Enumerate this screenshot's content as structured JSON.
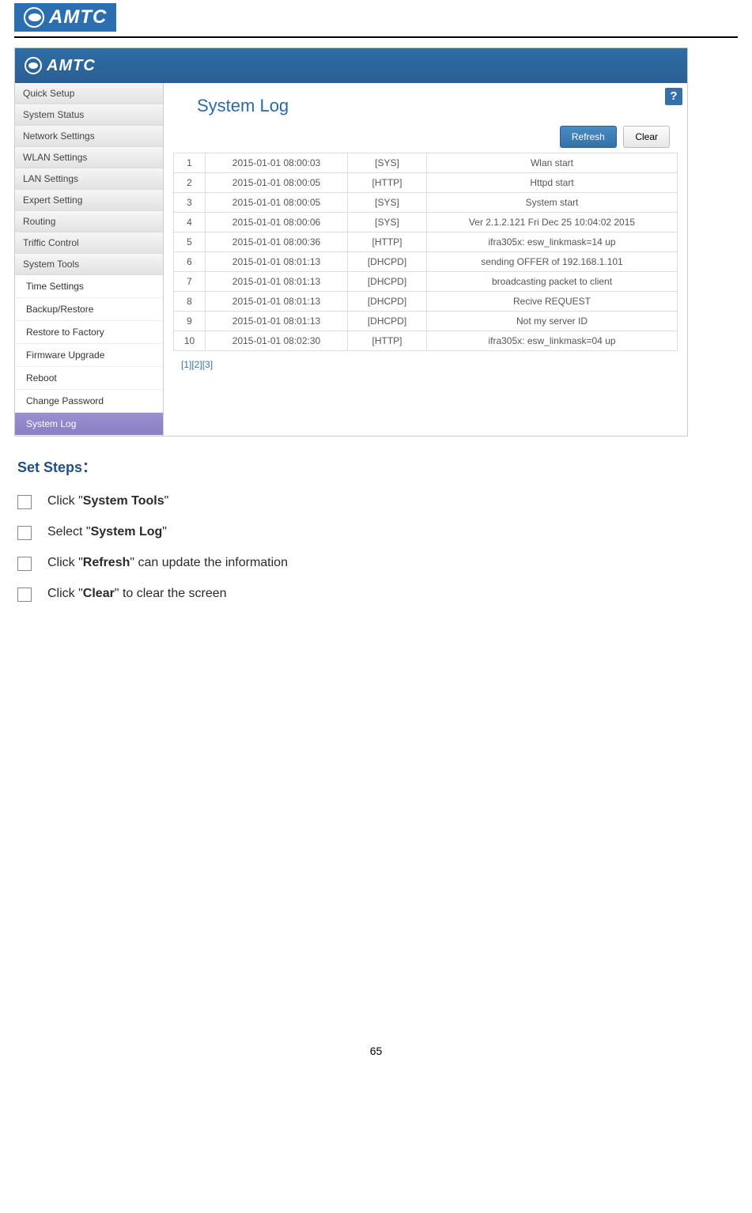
{
  "header": {
    "brand": "AMTC"
  },
  "screenshot": {
    "brand": "AMTC",
    "help_glyph": "?",
    "sidebar": {
      "main_items": [
        "Quick Setup",
        "System Status",
        "Network Settings",
        "WLAN Settings",
        "LAN Settings",
        "Expert Setting",
        "Routing",
        "Triffic Control",
        "System Tools"
      ],
      "sub_items": [
        "Time Settings",
        "Backup/Restore",
        "Restore to Factory",
        "Firmware Upgrade",
        "Reboot",
        "Change Password",
        "System Log"
      ],
      "active_sub": "System Log"
    },
    "panel": {
      "title": "System Log",
      "buttons": {
        "refresh": "Refresh",
        "clear": "Clear"
      },
      "rows": [
        {
          "n": "1",
          "time": "2015-01-01 08:00:03",
          "tag": "[SYS]",
          "msg": "Wlan start"
        },
        {
          "n": "2",
          "time": "2015-01-01 08:00:05",
          "tag": "[HTTP]",
          "msg": "Httpd start"
        },
        {
          "n": "3",
          "time": "2015-01-01 08:00:05",
          "tag": "[SYS]",
          "msg": "System start"
        },
        {
          "n": "4",
          "time": "2015-01-01 08:00:06",
          "tag": "[SYS]",
          "msg": "Ver 2.1.2.121 Fri Dec 25 10:04:02 2015"
        },
        {
          "n": "5",
          "time": "2015-01-01 08:00:36",
          "tag": "[HTTP]",
          "msg": "ifra305x: esw_linkmask=14 up"
        },
        {
          "n": "6",
          "time": "2015-01-01 08:01:13",
          "tag": "[DHCPD]",
          "msg": "sending OFFER of 192.168.1.101"
        },
        {
          "n": "7",
          "time": "2015-01-01 08:01:13",
          "tag": "[DHCPD]",
          "msg": "broadcasting packet to client"
        },
        {
          "n": "8",
          "time": "2015-01-01 08:01:13",
          "tag": "[DHCPD]",
          "msg": "Recive REQUEST"
        },
        {
          "n": "9",
          "time": "2015-01-01 08:01:13",
          "tag": "[DHCPD]",
          "msg": "Not my server ID"
        },
        {
          "n": "10",
          "time": "2015-01-01 08:02:30",
          "tag": "[HTTP]",
          "msg": "ifra305x: esw_linkmask=04 up"
        }
      ],
      "pager": {
        "p1": "[1]",
        "p2": "[2]",
        "p3": "[3]"
      }
    }
  },
  "doc": {
    "set_steps_heading": "Set Steps：",
    "steps": {
      "s1_pre": "Click \"",
      "s1_bold": "System Tools",
      "s1_post": "\"",
      "s2_pre": "Select \"",
      "s2_bold": "System Log",
      "s2_post": "\"",
      "s3_pre": "Click \"",
      "s3_bold": "Refresh",
      "s3_post": "\" can update the information",
      "s4_pre": "Click \"",
      "s4_bold": "Clear",
      "s4_post": "\" to clear the screen"
    },
    "page_number": "65"
  }
}
